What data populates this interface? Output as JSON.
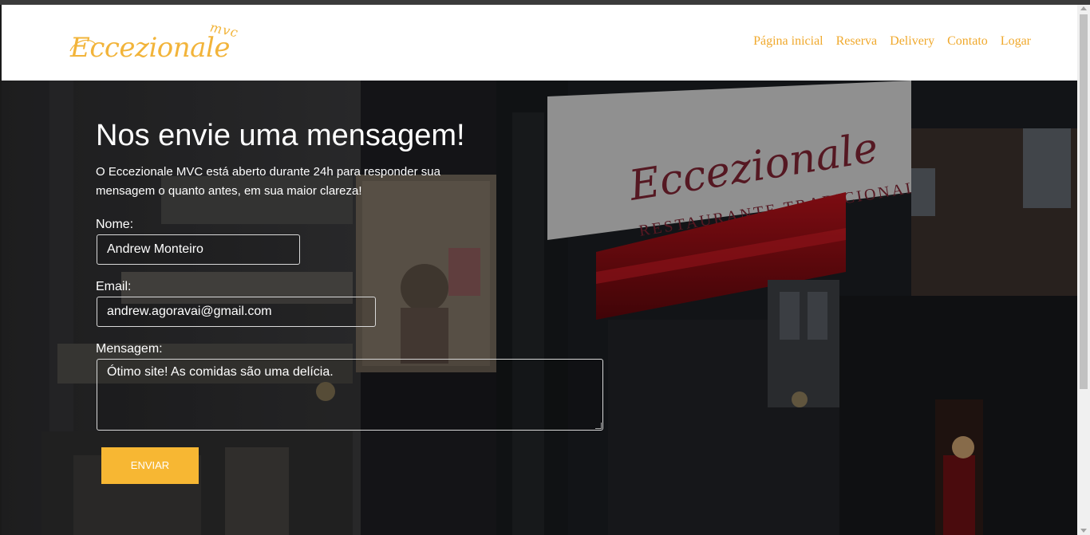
{
  "brand": {
    "logo_text": "Eccezionale",
    "logo_sub": "mvc",
    "accent_color": "#f2b43a"
  },
  "nav": {
    "items": [
      {
        "label": "Página inicial"
      },
      {
        "label": "Reserva"
      },
      {
        "label": "Delivery"
      },
      {
        "label": "Contato"
      },
      {
        "label": "Logar"
      }
    ]
  },
  "hero": {
    "sign_script": "Eccezionale",
    "sign_caption": "RESTAURANTE TRADICIONAL"
  },
  "contact": {
    "title": "Nos envie uma mensagem!",
    "subtitle": "O Eccezionale MVC está aberto durante 24h para responder sua mensagem o quanto antes, em sua maior clareza!",
    "name_label": "Nome:",
    "name_value": "Andrew Monteiro",
    "email_label": "Email:",
    "email_value": "andrew.agoravai@gmail.com",
    "message_label": "Mensagem:",
    "message_value": "Ótimo site! As comidas são uma delícia.",
    "send_label": "ENVIAR",
    "button_color": "#f7b733"
  }
}
